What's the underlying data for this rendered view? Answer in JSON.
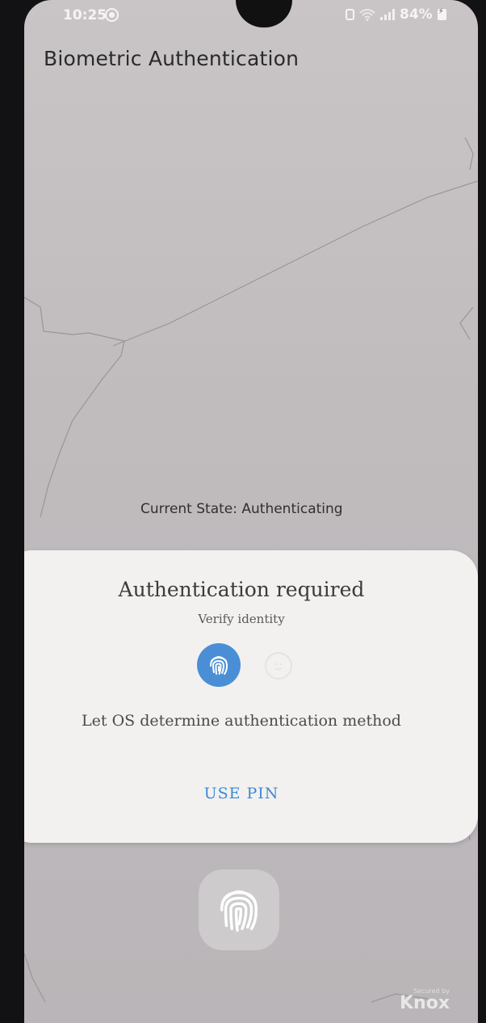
{
  "status_bar": {
    "time": "10:25",
    "battery_text": "84%"
  },
  "app": {
    "title": "Biometric Authentication",
    "current_state": "Current State: Authenticating"
  },
  "dialog": {
    "title": "Authentication required",
    "subtitle": "Verify identity",
    "description": "Let OS determine authentication method",
    "use_pin_label": "USE PIN",
    "modes": [
      "fingerprint-icon",
      "face-icon"
    ],
    "accent_color": "#4a8fd6"
  },
  "footer": {
    "secured_by": "Secured by",
    "knox": "Knox"
  }
}
